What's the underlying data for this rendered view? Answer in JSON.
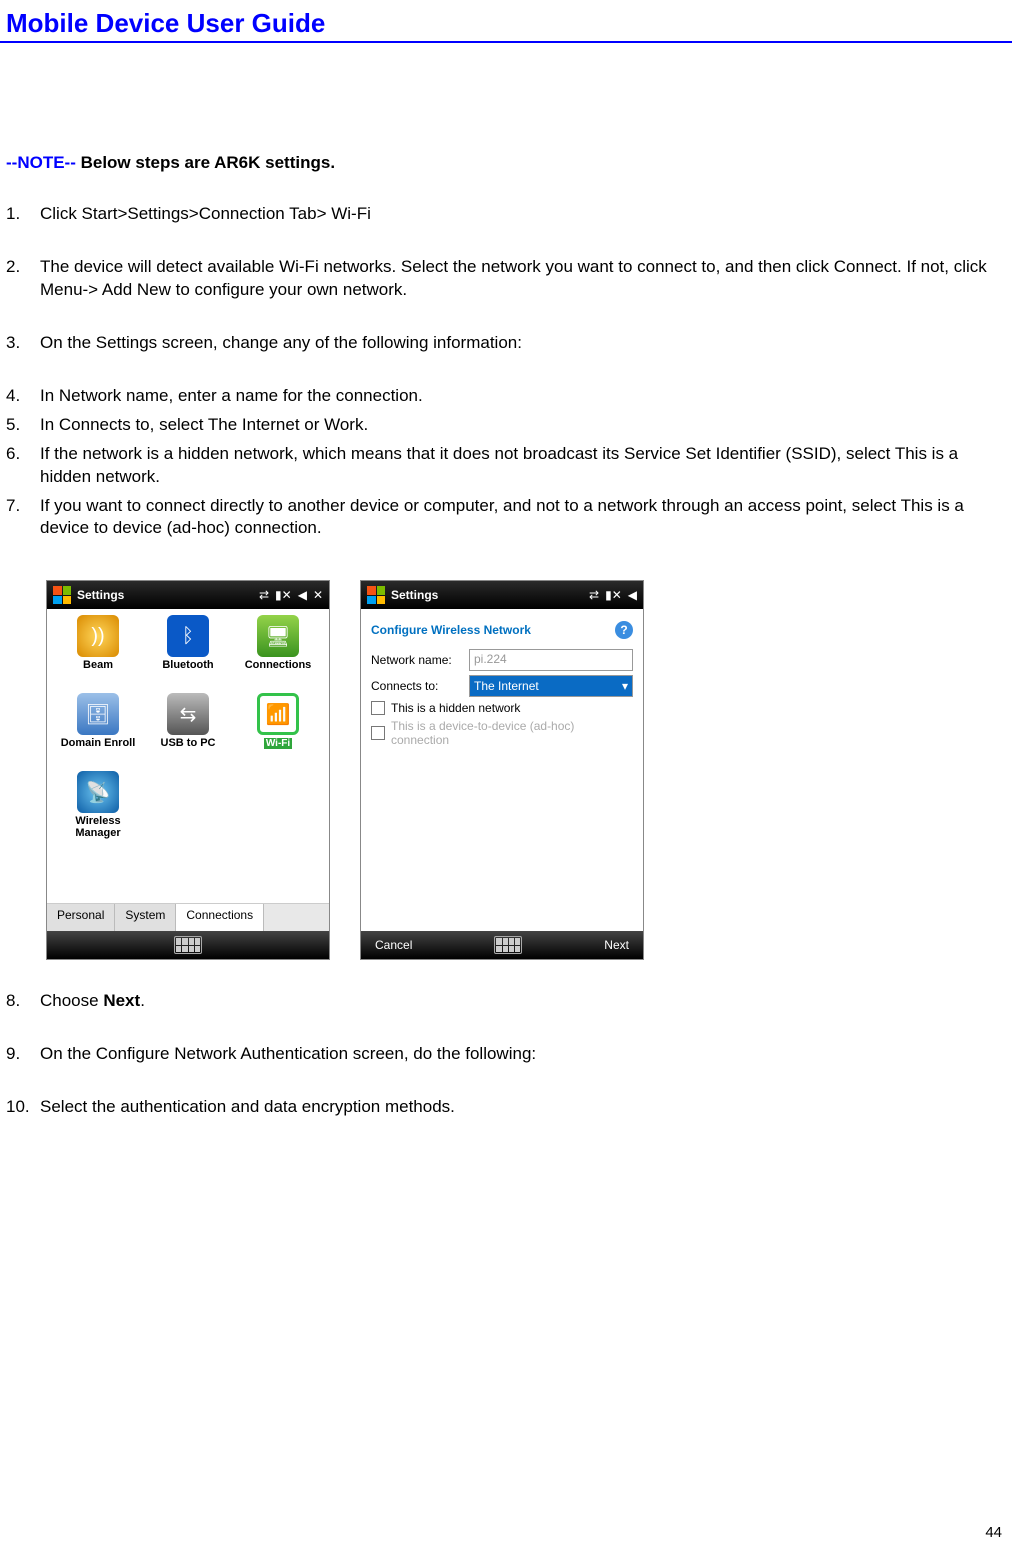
{
  "header": {
    "title": "Mobile Device User Guide"
  },
  "note": {
    "prefix": "--NOTE--",
    "text": " Below steps are AR6K settings."
  },
  "steps": {
    "s1": "Click Start>Settings>Connection Tab> Wi-Fi",
    "s2": "The device will detect available Wi-Fi networks. Select the network you want to connect to, and then click Connect. If not, click Menu-> Add New to configure your own network.",
    "s3": "On the Settings screen, change any of the following information:",
    "s4": "In Network name, enter a name for the connection.",
    "s5": "In Connects to, select The Internet or Work.",
    "s6": "If the network is a hidden network, which means that it does not broadcast its Service Set Identifier (SSID), select This is a hidden network.",
    "s7": "If you want to connect directly to another device or computer, and not to a network through an access point, select This is a device to device (ad-hoc) connection.",
    "s8_pre": "Choose ",
    "s8_bold": "Next",
    "s8_post": ".",
    "s9": "On the Configure Network Authentication screen, do the following:",
    "s10": "Select the authentication and data encryption methods."
  },
  "screen1": {
    "title": "Settings",
    "apps": {
      "beam": "Beam",
      "bluetooth": "Bluetooth",
      "connections": "Connections",
      "domain": "Domain Enroll",
      "usb": "USB to PC",
      "wifi": "Wi-Fi",
      "wireless": "Wireless Manager"
    },
    "tabs": {
      "personal": "Personal",
      "system": "System",
      "connections": "Connections"
    }
  },
  "screen2": {
    "title": "Settings",
    "heading": "Configure Wireless Network",
    "labels": {
      "name": "Network name:",
      "connects": "Connects to:"
    },
    "fields": {
      "name_value": "pi.224",
      "connects_value": "The Internet"
    },
    "chk1": "This is a hidden network",
    "chk2": "This is a device-to-device (ad-hoc) connection",
    "buttons": {
      "cancel": "Cancel",
      "next": "Next"
    }
  },
  "page_number": "44",
  "nums": {
    "n1": "1.",
    "n2": "2.",
    "n3": "3.",
    "n4": "4.",
    "n5": "5.",
    "n6": "6.",
    "n7": "7.",
    "n8": "8.",
    "n9": "9.",
    "n10": "10."
  }
}
